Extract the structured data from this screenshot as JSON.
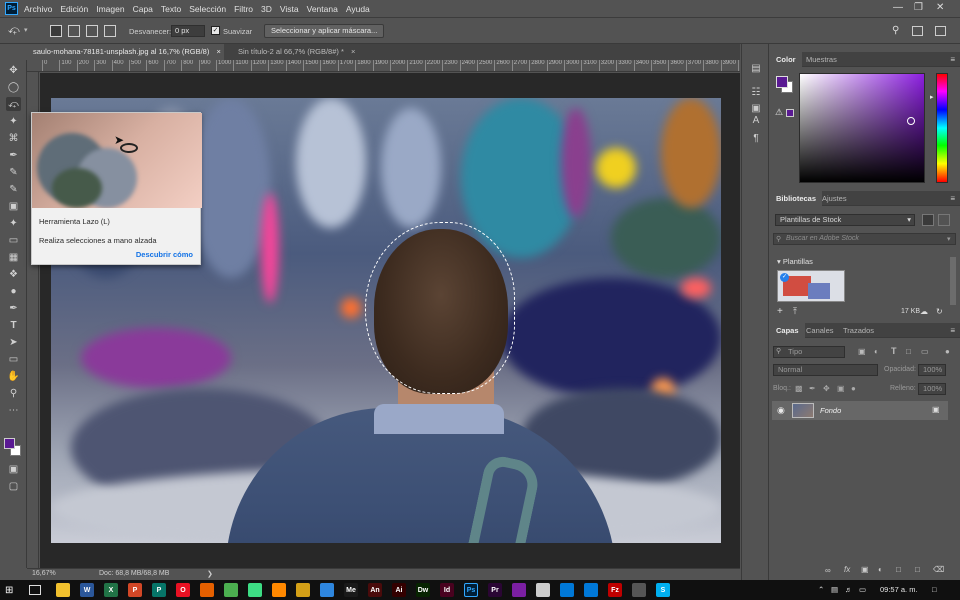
{
  "app": {
    "logo": "Ps"
  },
  "menu": {
    "items": [
      "Archivo",
      "Edición",
      "Imagen",
      "Capa",
      "Texto",
      "Selección",
      "Filtro",
      "3D",
      "Vista",
      "Ventana",
      "Ayuda"
    ]
  },
  "options": {
    "feather_label": "Desvanecer:",
    "feather_value": "0 px",
    "antialias_label": "Suavizar",
    "select_mask_button": "Seleccionar y aplicar máscara..."
  },
  "tabs": [
    {
      "label": "saulo-mohana-78181-unsplash.jpg al 16,7% (RGB/8)",
      "close": "×",
      "active": true
    },
    {
      "label": "Sin título-2 al 66,7% (RGB/8#) *",
      "close": "×",
      "active": false
    }
  ],
  "ruler": {
    "ticks": [
      "0",
      "100",
      "200",
      "300",
      "400",
      "500",
      "600",
      "700",
      "800",
      "900",
      "1000",
      "1100",
      "1200",
      "1300",
      "1400",
      "1500",
      "1600",
      "1700",
      "1800",
      "1900",
      "2000",
      "2100",
      "2200",
      "2300",
      "2400",
      "2500",
      "2600",
      "2700",
      "2800",
      "2900",
      "3000",
      "3100",
      "3200",
      "3300",
      "3400",
      "3500",
      "3600",
      "3700",
      "3800",
      "3900",
      "400"
    ]
  },
  "tooltip": {
    "title": "Herramienta Lazo (L)",
    "description": "Realiza selecciones a mano alzada",
    "link": "Descubrir cómo"
  },
  "status": {
    "zoom": "16,67%",
    "doc": "Doc: 68,8 MB/68,8 MB"
  },
  "color_panel": {
    "tabs": [
      "Color",
      "Muestras"
    ],
    "foreground": "#5a1a93",
    "background": "#ffffff"
  },
  "libraries_panel": {
    "tabs": [
      "Bibliotecas",
      "Ajustes"
    ],
    "library_select": "Plantillas de Stock",
    "search_placeholder": "Buscar en Adobe Stock",
    "section": "Plantillas",
    "size": "17 KB"
  },
  "layers_panel": {
    "tabs": [
      "Capas",
      "Canales",
      "Trazados"
    ],
    "filter": "Tipo",
    "blend_mode": "Normal",
    "opacity_label": "Opacidad:",
    "opacity_value": "100%",
    "lock_label": "Bloq.:",
    "fill_label": "Relleno:",
    "fill_value": "100%",
    "layers": [
      {
        "name": "Fondo",
        "visible": true,
        "locked": true
      }
    ]
  },
  "taskbar": {
    "apps": [
      {
        "icon": "file-explorer-icon",
        "color": "#f2c12e",
        "text": ""
      },
      {
        "icon": "word-icon",
        "color": "#2b579a",
        "text": "W"
      },
      {
        "icon": "excel-icon",
        "color": "#217346",
        "text": "X"
      },
      {
        "icon": "powerpoint-icon",
        "color": "#d24726",
        "text": "P"
      },
      {
        "icon": "publisher-icon",
        "color": "#077568",
        "text": "P"
      },
      {
        "icon": "opera-icon",
        "color": "#e81123",
        "text": "O"
      },
      {
        "icon": "firefox-icon",
        "color": "#e66000",
        "text": ""
      },
      {
        "icon": "chrome-icon",
        "color": "#4caf50",
        "text": ""
      },
      {
        "icon": "android-icon",
        "color": "#3ddc84",
        "text": ""
      },
      {
        "icon": "vlc-icon",
        "color": "#ff8800",
        "text": ""
      },
      {
        "icon": "app-icon",
        "color": "#d4a017",
        "text": ""
      },
      {
        "icon": "cube-icon",
        "color": "#2e86de",
        "text": ""
      },
      {
        "icon": "media-encoder-icon",
        "color": "#1a1a1a",
        "text": "Me"
      },
      {
        "icon": "animate-icon",
        "color": "#4a0b0b",
        "text": "An"
      },
      {
        "icon": "illustrator-icon",
        "color": "#330000",
        "text": "Ai"
      },
      {
        "icon": "dreamweaver-icon",
        "color": "#072401",
        "text": "Dw"
      },
      {
        "icon": "indesign-icon",
        "color": "#49021f",
        "text": "Id"
      },
      {
        "icon": "photoshop-icon",
        "color": "#001e36",
        "text": "Ps"
      },
      {
        "icon": "premiere-icon",
        "color": "#2a0634",
        "text": "Pr"
      },
      {
        "icon": "app-icon",
        "color": "#7b1fa2",
        "text": ""
      },
      {
        "icon": "steam-icon",
        "color": "#cccccc",
        "text": ""
      },
      {
        "icon": "photos-icon",
        "color": "#0078d7",
        "text": ""
      },
      {
        "icon": "windows-icon",
        "color": "#0078d7",
        "text": ""
      },
      {
        "icon": "filezilla-icon",
        "color": "#bf0000",
        "text": "Fz"
      },
      {
        "icon": "app-icon",
        "color": "#555555",
        "text": ""
      },
      {
        "icon": "skype-icon",
        "color": "#00aff0",
        "text": "S"
      }
    ],
    "time": "09:57 a. m."
  }
}
